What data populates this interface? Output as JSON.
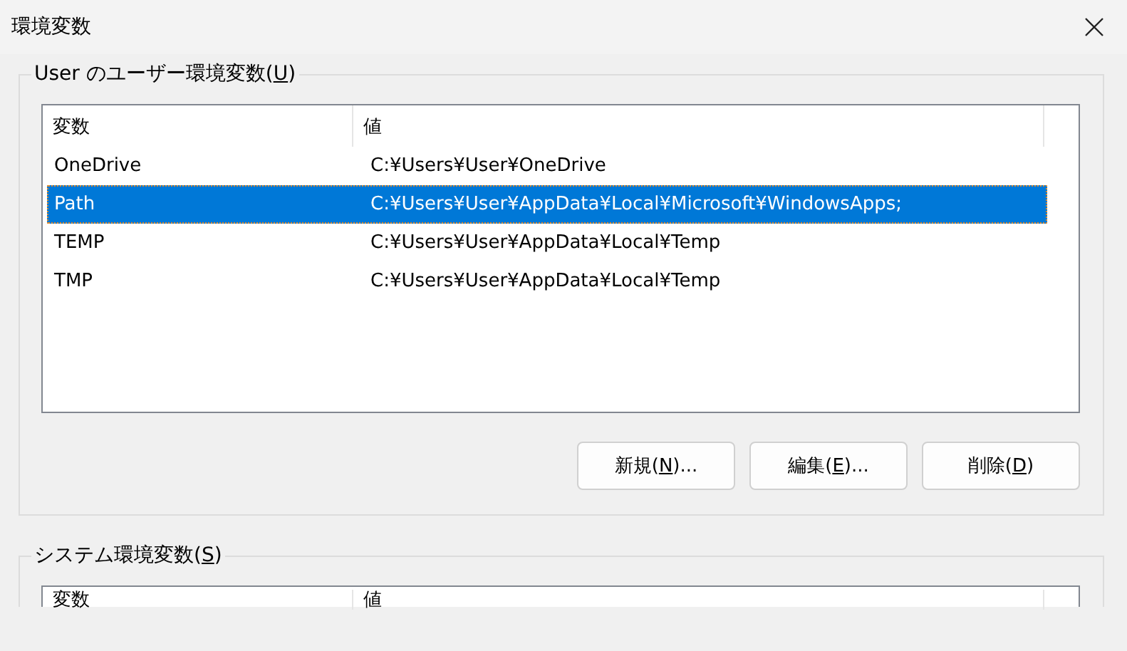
{
  "window": {
    "title": "環境変数"
  },
  "user_group": {
    "title": {
      "before": "User のユーザー環境変数(",
      "key": "U",
      "after": ")"
    },
    "columns": [
      "変数",
      "値"
    ],
    "rows": [
      {
        "variable": "OneDrive",
        "value": "C:¥Users¥User¥OneDrive",
        "selected": false
      },
      {
        "variable": "Path",
        "value": "C:¥Users¥User¥AppData¥Local¥Microsoft¥WindowsApps;",
        "selected": true
      },
      {
        "variable": "TEMP",
        "value": "C:¥Users¥User¥AppData¥Local¥Temp",
        "selected": false
      },
      {
        "variable": "TMP",
        "value": "C:¥Users¥User¥AppData¥Local¥Temp",
        "selected": false
      }
    ],
    "buttons": [
      {
        "before": "新規(",
        "key": "N",
        "after": ")..."
      },
      {
        "before": "編集(",
        "key": "E",
        "after": ")..."
      },
      {
        "before": "削除(",
        "key": "D",
        "after": ")"
      }
    ]
  },
  "system_group": {
    "title": {
      "before": "システム環境変数(",
      "key": "S",
      "after": ")"
    },
    "columns": [
      "変数",
      "値"
    ]
  }
}
